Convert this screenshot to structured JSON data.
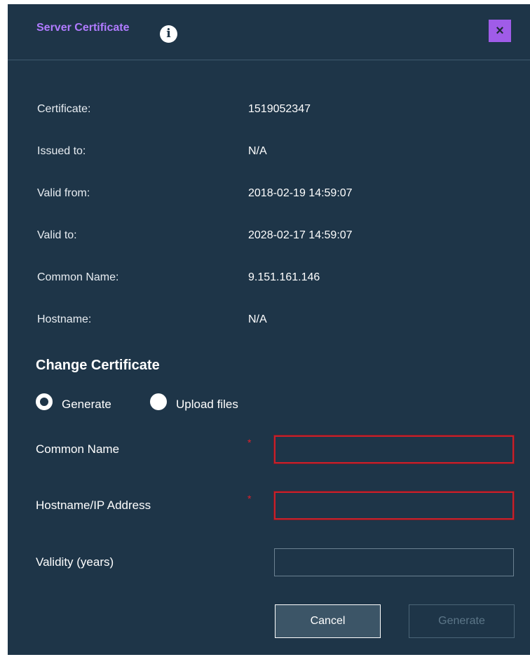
{
  "dialog": {
    "title": "Server Certificate",
    "info_icon": "i",
    "close_icon": "×"
  },
  "details": [
    {
      "label": "Certificate:",
      "value": "1519052347"
    },
    {
      "label": "Issued to:",
      "value": "N/A"
    },
    {
      "label": "Valid from:",
      "value": "2018-02-19 14:59:07"
    },
    {
      "label": "Valid to:",
      "value": "2028-02-17 14:59:07"
    },
    {
      "label": "Common Name:",
      "value": "9.151.161.146"
    },
    {
      "label": "Hostname:",
      "value": "N/A"
    }
  ],
  "change": {
    "title": "Change Certificate",
    "options": [
      {
        "label": "Generate",
        "selected": true
      },
      {
        "label": "Upload files",
        "selected": false
      }
    ]
  },
  "form": {
    "common_name": {
      "label": "Common Name",
      "required": "*",
      "value": ""
    },
    "hostname": {
      "label": "Hostname/IP Address",
      "required": "*",
      "value": ""
    },
    "validity": {
      "label": "Validity (years)",
      "value": ""
    }
  },
  "buttons": {
    "cancel": "Cancel",
    "generate": "Generate"
  },
  "colors": {
    "background": "#1e3548",
    "title": "#b07bff",
    "close": "#a05ce8",
    "error": "#c8202a"
  }
}
